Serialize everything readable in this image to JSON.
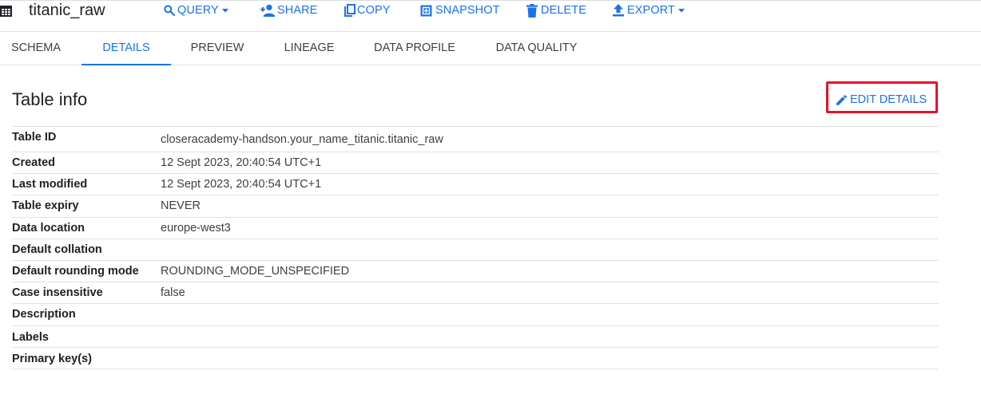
{
  "toolbar": {
    "title": "titanic_raw",
    "query": "QUERY",
    "share": "SHARE",
    "copy": "COPY",
    "snapshot": "SNAPSHOT",
    "delete": "DELETE",
    "export": "EXPORT"
  },
  "tabs": [
    {
      "label": "SCHEMA"
    },
    {
      "label": "DETAILS",
      "active": true
    },
    {
      "label": "PREVIEW"
    },
    {
      "label": "LINEAGE"
    },
    {
      "label": "DATA PROFILE"
    },
    {
      "label": "DATA QUALITY"
    }
  ],
  "section": {
    "title": "Table info",
    "edit_label": "EDIT DETAILS"
  },
  "info": [
    {
      "label": "Table ID",
      "value": "closeracademy-handson.your_name_titanic.titanic_raw"
    },
    {
      "label": "Created",
      "value": "12 Sept 2023, 20:40:54 UTC+1"
    },
    {
      "label": "Last modified",
      "value": "12 Sept 2023, 20:40:54 UTC+1"
    },
    {
      "label": "Table expiry",
      "value": "NEVER"
    },
    {
      "label": "Data location",
      "value": "europe-west3"
    },
    {
      "label": "Default collation",
      "value": ""
    },
    {
      "label": "Default rounding mode",
      "value": "ROUNDING_MODE_UNSPECIFIED"
    },
    {
      "label": "Case insensitive",
      "value": "false"
    },
    {
      "label": "Description",
      "value": ""
    },
    {
      "label": "Labels",
      "value": ""
    },
    {
      "label": "Primary key(s)",
      "value": ""
    }
  ],
  "colors": {
    "accent": "#1a73e8",
    "highlight": "#e8102a",
    "divider": "#e0e0e0"
  },
  "icons": {
    "table": "table-icon",
    "query": "search-icon",
    "share": "person-add-icon",
    "copy": "copy-icon",
    "snapshot": "snapshot-icon",
    "delete": "trash-icon",
    "export": "upload-icon",
    "edit": "pencil-icon"
  }
}
